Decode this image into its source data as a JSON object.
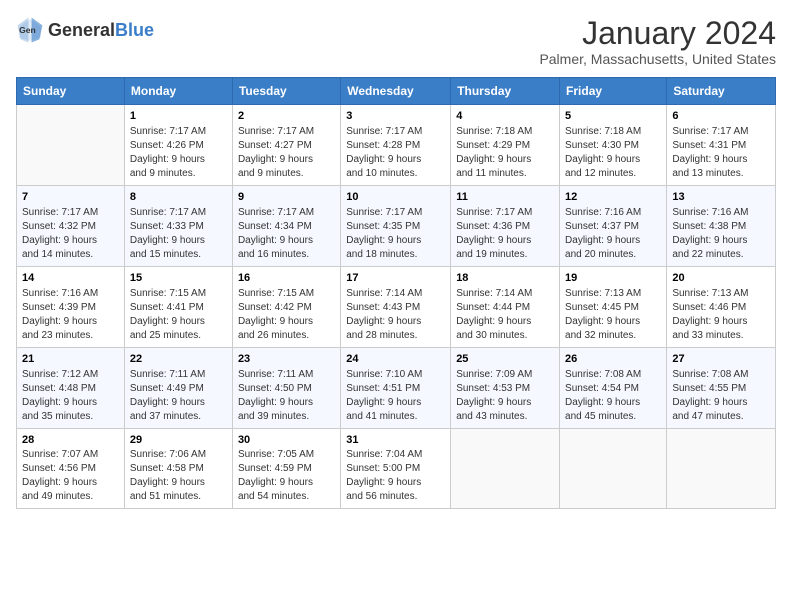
{
  "header": {
    "logo_general": "General",
    "logo_blue": "Blue",
    "title": "January 2024",
    "subtitle": "Palmer, Massachusetts, United States"
  },
  "columns": [
    "Sunday",
    "Monday",
    "Tuesday",
    "Wednesday",
    "Thursday",
    "Friday",
    "Saturday"
  ],
  "weeks": [
    [
      {
        "date": "",
        "info": ""
      },
      {
        "date": "1",
        "info": "Sunrise: 7:17 AM\nSunset: 4:26 PM\nDaylight: 9 hours\nand 9 minutes."
      },
      {
        "date": "2",
        "info": "Sunrise: 7:17 AM\nSunset: 4:27 PM\nDaylight: 9 hours\nand 9 minutes."
      },
      {
        "date": "3",
        "info": "Sunrise: 7:17 AM\nSunset: 4:28 PM\nDaylight: 9 hours\nand 10 minutes."
      },
      {
        "date": "4",
        "info": "Sunrise: 7:18 AM\nSunset: 4:29 PM\nDaylight: 9 hours\nand 11 minutes."
      },
      {
        "date": "5",
        "info": "Sunrise: 7:18 AM\nSunset: 4:30 PM\nDaylight: 9 hours\nand 12 minutes."
      },
      {
        "date": "6",
        "info": "Sunrise: 7:17 AM\nSunset: 4:31 PM\nDaylight: 9 hours\nand 13 minutes."
      }
    ],
    [
      {
        "date": "7",
        "info": "Sunrise: 7:17 AM\nSunset: 4:32 PM\nDaylight: 9 hours\nand 14 minutes."
      },
      {
        "date": "8",
        "info": "Sunrise: 7:17 AM\nSunset: 4:33 PM\nDaylight: 9 hours\nand 15 minutes."
      },
      {
        "date": "9",
        "info": "Sunrise: 7:17 AM\nSunset: 4:34 PM\nDaylight: 9 hours\nand 16 minutes."
      },
      {
        "date": "10",
        "info": "Sunrise: 7:17 AM\nSunset: 4:35 PM\nDaylight: 9 hours\nand 18 minutes."
      },
      {
        "date": "11",
        "info": "Sunrise: 7:17 AM\nSunset: 4:36 PM\nDaylight: 9 hours\nand 19 minutes."
      },
      {
        "date": "12",
        "info": "Sunrise: 7:16 AM\nSunset: 4:37 PM\nDaylight: 9 hours\nand 20 minutes."
      },
      {
        "date": "13",
        "info": "Sunrise: 7:16 AM\nSunset: 4:38 PM\nDaylight: 9 hours\nand 22 minutes."
      }
    ],
    [
      {
        "date": "14",
        "info": "Sunrise: 7:16 AM\nSunset: 4:39 PM\nDaylight: 9 hours\nand 23 minutes."
      },
      {
        "date": "15",
        "info": "Sunrise: 7:15 AM\nSunset: 4:41 PM\nDaylight: 9 hours\nand 25 minutes."
      },
      {
        "date": "16",
        "info": "Sunrise: 7:15 AM\nSunset: 4:42 PM\nDaylight: 9 hours\nand 26 minutes."
      },
      {
        "date": "17",
        "info": "Sunrise: 7:14 AM\nSunset: 4:43 PM\nDaylight: 9 hours\nand 28 minutes."
      },
      {
        "date": "18",
        "info": "Sunrise: 7:14 AM\nSunset: 4:44 PM\nDaylight: 9 hours\nand 30 minutes."
      },
      {
        "date": "19",
        "info": "Sunrise: 7:13 AM\nSunset: 4:45 PM\nDaylight: 9 hours\nand 32 minutes."
      },
      {
        "date": "20",
        "info": "Sunrise: 7:13 AM\nSunset: 4:46 PM\nDaylight: 9 hours\nand 33 minutes."
      }
    ],
    [
      {
        "date": "21",
        "info": "Sunrise: 7:12 AM\nSunset: 4:48 PM\nDaylight: 9 hours\nand 35 minutes."
      },
      {
        "date": "22",
        "info": "Sunrise: 7:11 AM\nSunset: 4:49 PM\nDaylight: 9 hours\nand 37 minutes."
      },
      {
        "date": "23",
        "info": "Sunrise: 7:11 AM\nSunset: 4:50 PM\nDaylight: 9 hours\nand 39 minutes."
      },
      {
        "date": "24",
        "info": "Sunrise: 7:10 AM\nSunset: 4:51 PM\nDaylight: 9 hours\nand 41 minutes."
      },
      {
        "date": "25",
        "info": "Sunrise: 7:09 AM\nSunset: 4:53 PM\nDaylight: 9 hours\nand 43 minutes."
      },
      {
        "date": "26",
        "info": "Sunrise: 7:08 AM\nSunset: 4:54 PM\nDaylight: 9 hours\nand 45 minutes."
      },
      {
        "date": "27",
        "info": "Sunrise: 7:08 AM\nSunset: 4:55 PM\nDaylight: 9 hours\nand 47 minutes."
      }
    ],
    [
      {
        "date": "28",
        "info": "Sunrise: 7:07 AM\nSunset: 4:56 PM\nDaylight: 9 hours\nand 49 minutes."
      },
      {
        "date": "29",
        "info": "Sunrise: 7:06 AM\nSunset: 4:58 PM\nDaylight: 9 hours\nand 51 minutes."
      },
      {
        "date": "30",
        "info": "Sunrise: 7:05 AM\nSunset: 4:59 PM\nDaylight: 9 hours\nand 54 minutes."
      },
      {
        "date": "31",
        "info": "Sunrise: 7:04 AM\nSunset: 5:00 PM\nDaylight: 9 hours\nand 56 minutes."
      },
      {
        "date": "",
        "info": ""
      },
      {
        "date": "",
        "info": ""
      },
      {
        "date": "",
        "info": ""
      }
    ]
  ]
}
